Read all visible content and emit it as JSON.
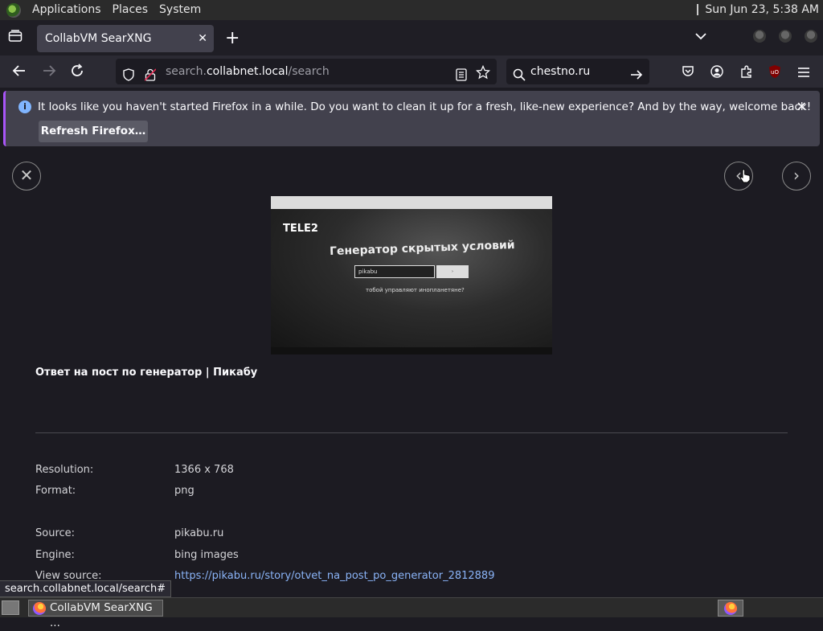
{
  "top_panel": {
    "menus": [
      "Applications",
      "Places",
      "System"
    ],
    "clock": "Sun Jun 23,  5:38 AM"
  },
  "browser": {
    "tab_title": "CollabVM SearXNG",
    "url_domain_prefix": "search.",
    "url_domain": "collabnet.local",
    "url_path": "/search",
    "search_query": "chestno.ru"
  },
  "notification": {
    "message": "It looks like you haven't started Firefox in a while. Do you want to clean it up for a fresh, like-new experience? And by the way, welcome back!",
    "button": "Refresh Firefox…"
  },
  "preview": {
    "logo": "TELE2",
    "heading": "Генератор скрытых условий",
    "input_value": "pikabu",
    "question": "тобой управляют инопланетяне?"
  },
  "result": {
    "title": "Ответ на пост по генератор | Пикабу",
    "details": [
      {
        "label": "Resolution:",
        "value": "1366 x 768"
      },
      {
        "label": "Format:",
        "value": "png"
      },
      {
        "label": "Source:",
        "value": "pikabu.ru"
      },
      {
        "label": "Engine:",
        "value": "bing images"
      },
      {
        "label": "View source:",
        "value": "https://pikabu.ru/story/otvet_na_post_po_generator_2812889"
      }
    ]
  },
  "status_url": "search.collabnet.local/search#",
  "taskbar": {
    "task_label": "CollabVM SearXNG ..."
  }
}
